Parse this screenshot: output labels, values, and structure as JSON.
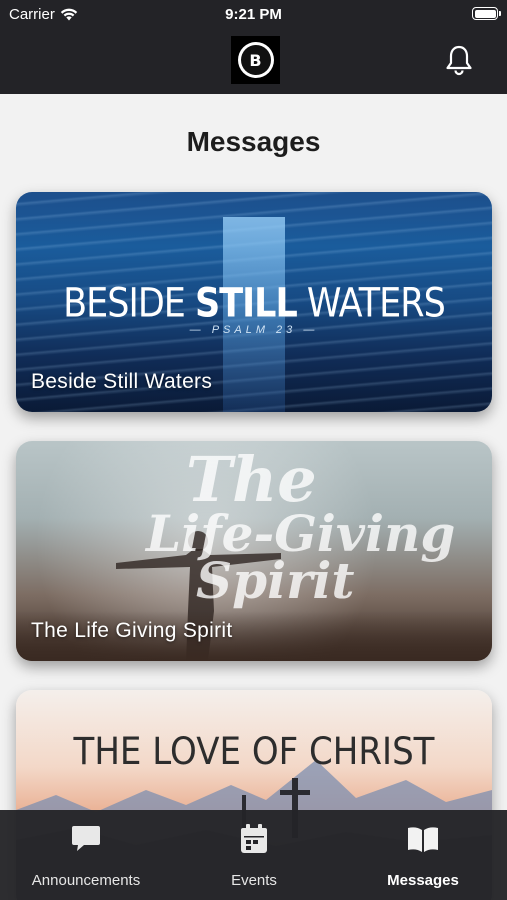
{
  "status_bar": {
    "carrier": "Carrier",
    "time": "9:21 PM"
  },
  "header": {
    "logo_letter": "B",
    "notification_icon": "bell-icon"
  },
  "page": {
    "title": "Messages"
  },
  "messages": [
    {
      "label": "Beside Still Waters",
      "art_title_light": "BESIDE ",
      "art_title_bold": "STILL",
      "art_title_light2": " WATERS",
      "art_subtitle": "— PSALM 23 —"
    },
    {
      "label": "The Life Giving Spirit",
      "art_line1": "The",
      "art_line2": "Life-Giving",
      "art_line3": "Spirit"
    },
    {
      "label": "",
      "art_title": "THE LOVE OF CHRIST"
    }
  ],
  "tab_bar": {
    "tabs": [
      {
        "label": "Announcements",
        "icon": "chat-bubble-icon",
        "active": false
      },
      {
        "label": "Events",
        "icon": "calendar-icon",
        "active": false
      },
      {
        "label": "Messages",
        "icon": "book-icon",
        "active": true
      }
    ]
  },
  "colors": {
    "header_bg": "#232327",
    "page_bg": "#f2f2f2",
    "tab_bar_bg": "#242428"
  }
}
